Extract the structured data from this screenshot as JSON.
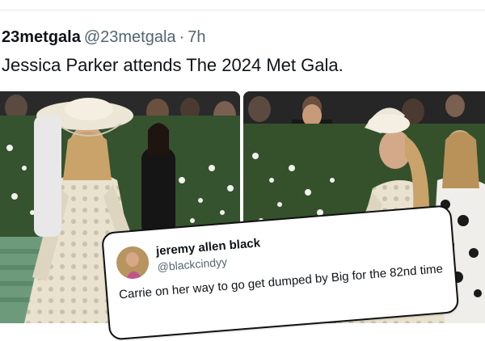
{
  "tweet": {
    "display_name": "23metgala",
    "handle": "@23metgala",
    "separator": "·",
    "time": "7h",
    "text": "Jessica Parker attends The 2024 Met Gala."
  },
  "media": {
    "photos": [
      {
        "subject": "woman-in-embellished-gown-with-wide-hat"
      },
      {
        "subject": "woman-in-embellished-gown-with-sculptural-fascinator"
      }
    ]
  },
  "quote_overlay": {
    "name": "jeremy allen black",
    "handle": "@blackcindyy",
    "text": "Carrie on her way to go get dumped by Big for the 82nd time"
  },
  "colors": {
    "text_primary": "#0f1419",
    "text_secondary": "#536471",
    "quote_border": "#111111"
  }
}
